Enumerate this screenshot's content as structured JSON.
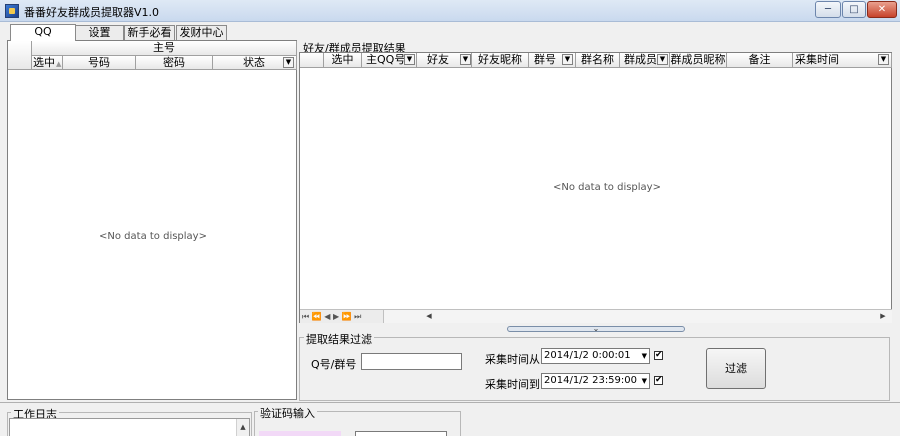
{
  "window": {
    "title": "番番好友群成员提取器V1.0",
    "min": "─",
    "max": "□",
    "close": "✕"
  },
  "tabs": [
    {
      "label": "QQ"
    },
    {
      "label": "设置"
    },
    {
      "label": "新手必看"
    },
    {
      "label": "发财中心"
    }
  ],
  "left_grid": {
    "band": "主号",
    "columns": [
      "选中",
      "号码",
      "密码",
      "状态"
    ],
    "sort_arrow": "▲",
    "empty": "<No data to display>"
  },
  "right_panel": {
    "title": "好友/群成员提取结果",
    "columns": [
      "选中",
      "主QQ号",
      "好友",
      "好友昵称",
      "群号",
      "群名称",
      "群成员",
      "群成员昵称",
      "备注",
      "采集时间"
    ],
    "empty": "<No data to display>",
    "nav": "⏮ ⏪ ◀ ▶ ⏩ ⏭"
  },
  "filter": {
    "title": "提取结果过滤",
    "q_label": "Q号/群号",
    "q_value": "",
    "from_label": "采集时间从",
    "from_value": "2014/1/2 0:00:01",
    "to_label": "采集时间到",
    "to_value": "2014/1/2 23:59:00",
    "button": "过滤"
  },
  "log": {
    "title": "工作日志"
  },
  "captcha": {
    "title": "验证码输入"
  },
  "icons": {
    "dropdown": "▼",
    "check": "✔",
    "collapse": "⌄",
    "scroll_up": "▲",
    "scroll_left": "◀",
    "scroll_right": "▶"
  }
}
